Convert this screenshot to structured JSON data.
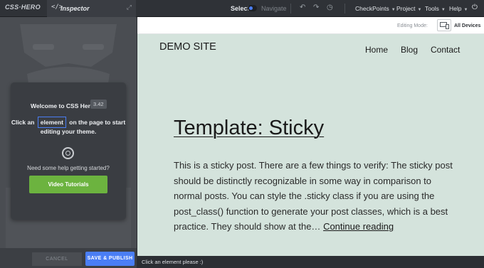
{
  "app": {
    "logo": "CSS·HERO",
    "inspector_tab": "Inspector"
  },
  "toolbar": {
    "select_label": "Select",
    "navigate_label": "Navigate",
    "mode_selected": "Select",
    "menus": [
      "CheckPoints",
      "Project",
      "Tools",
      "Help"
    ]
  },
  "welcome": {
    "title": "Welcome to CSS Hero",
    "version": "3.42",
    "line1_before": "Click an",
    "line1_highlight": "element",
    "line1_after": "on the page to start",
    "line2": "editing your theme.",
    "help_text": "Need some help getting started?",
    "video_button": "Video Tutorials"
  },
  "footer_buttons": {
    "cancel": "CANCEL",
    "publish": "SAVE & PUBLISH"
  },
  "editing": {
    "label": "Editing Mode:",
    "device": "All Devices"
  },
  "site": {
    "title": "DEMO SITE",
    "nav": [
      "Home",
      "Blog",
      "Contact"
    ]
  },
  "post": {
    "title": "Template: Sticky",
    "excerpt": "This is a sticky post. There are a few things to verify: The sticky post should be distinctly recognizable in some way in comparison to normal posts. You can style the .sticky class if you are using the post_class() function to generate your post classes, which is a best practice. They should show at the…",
    "continue": "Continue reading"
  },
  "status": {
    "message": "Click an element please :)"
  },
  "colors": {
    "accent": "#4a7ef5",
    "video_button": "#6cb33f",
    "preview_bg": "#d4e3dc",
    "toolbar_bg": "#2f3237"
  }
}
